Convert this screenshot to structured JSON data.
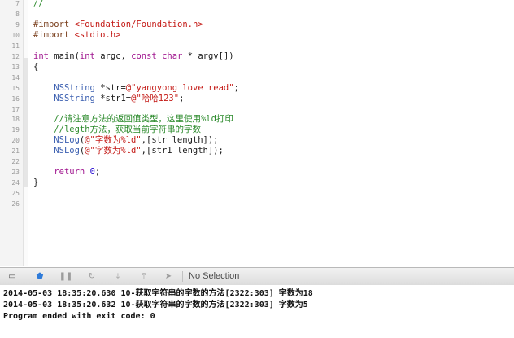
{
  "editor": {
    "line_numbers": [
      "7",
      "8",
      "9",
      "10",
      "11",
      "12",
      "13",
      "14",
      "15",
      "16",
      "17",
      "18",
      "19",
      "20",
      "21",
      "22",
      "23",
      "24",
      "25",
      "26"
    ],
    "lines": [
      {
        "indent": "",
        "tokens": [
          {
            "t": "//",
            "c": "comment"
          }
        ]
      },
      {
        "indent": "",
        "tokens": []
      },
      {
        "indent": "",
        "tokens": [
          {
            "t": "#import ",
            "c": "pre"
          },
          {
            "t": "<Foundation/Foundation.h>",
            "c": "string"
          }
        ]
      },
      {
        "indent": "",
        "tokens": [
          {
            "t": "#import ",
            "c": "pre"
          },
          {
            "t": "<stdio.h>",
            "c": "string"
          }
        ]
      },
      {
        "indent": "",
        "tokens": []
      },
      {
        "indent": "",
        "tokens": [
          {
            "t": "int",
            "c": "keyword"
          },
          {
            "t": " main(",
            "c": "plain"
          },
          {
            "t": "int",
            "c": "keyword"
          },
          {
            "t": " argc, ",
            "c": "plain"
          },
          {
            "t": "const",
            "c": "keyword"
          },
          {
            "t": " ",
            "c": "plain"
          },
          {
            "t": "char",
            "c": "keyword"
          },
          {
            "t": " * argv[])",
            "c": "plain"
          }
        ]
      },
      {
        "indent": "",
        "tokens": [
          {
            "t": "{",
            "c": "plain"
          }
        ]
      },
      {
        "indent": "",
        "tokens": []
      },
      {
        "indent": "    ",
        "tokens": [
          {
            "t": "NSString",
            "c": "type"
          },
          {
            "t": " *str=",
            "c": "plain"
          },
          {
            "t": "@\"yangyong love read\"",
            "c": "string"
          },
          {
            "t": ";",
            "c": "plain"
          }
        ]
      },
      {
        "indent": "    ",
        "tokens": [
          {
            "t": "NSString",
            "c": "type"
          },
          {
            "t": " *str1=",
            "c": "plain"
          },
          {
            "t": "@\"哈哈123\"",
            "c": "string"
          },
          {
            "t": ";",
            "c": "plain"
          }
        ]
      },
      {
        "indent": "",
        "tokens": []
      },
      {
        "indent": "    ",
        "tokens": [
          {
            "t": "//请注意方法的返回值类型，这里使用%ld打印",
            "c": "comment"
          }
        ]
      },
      {
        "indent": "    ",
        "tokens": [
          {
            "t": "//legth方法，获取当前字符串的字数",
            "c": "comment"
          }
        ]
      },
      {
        "indent": "    ",
        "tokens": [
          {
            "t": "NSLog",
            "c": "type"
          },
          {
            "t": "(",
            "c": "plain"
          },
          {
            "t": "@\"字数为%ld\"",
            "c": "string"
          },
          {
            "t": ",[str length]);",
            "c": "plain"
          }
        ]
      },
      {
        "indent": "    ",
        "tokens": [
          {
            "t": "NSLog",
            "c": "type"
          },
          {
            "t": "(",
            "c": "plain"
          },
          {
            "t": "@\"字数为%ld\"",
            "c": "string"
          },
          {
            "t": ",[str1 length]);",
            "c": "plain"
          }
        ]
      },
      {
        "indent": "",
        "tokens": []
      },
      {
        "indent": "    ",
        "tokens": [
          {
            "t": "return",
            "c": "keyword"
          },
          {
            "t": " ",
            "c": "plain"
          },
          {
            "t": "0",
            "c": "number"
          },
          {
            "t": ";",
            "c": "plain"
          }
        ]
      },
      {
        "indent": "",
        "tokens": [
          {
            "t": "}",
            "c": "plain"
          }
        ]
      },
      {
        "indent": "",
        "tokens": []
      },
      {
        "indent": "",
        "tokens": []
      }
    ]
  },
  "debug_bar": {
    "buttons": [
      {
        "name": "hide-debug-area-icon",
        "glyph": "▭"
      },
      {
        "name": "breakpoints-toggle-icon",
        "glyph": "⬟"
      },
      {
        "name": "pause-icon",
        "glyph": "❚❚"
      },
      {
        "name": "continue-icon",
        "glyph": "↻"
      },
      {
        "name": "step-into-icon",
        "glyph": "⤓"
      },
      {
        "name": "step-out-icon",
        "glyph": "⤒"
      },
      {
        "name": "location-icon",
        "glyph": "➤"
      }
    ],
    "selection_label": "No Selection"
  },
  "console": {
    "lines": [
      "2014-05-03 18:35:20.630 10-获取字符串的字数的方法[2322:303] 字数为18",
      "2014-05-03 18:35:20.632 10-获取字符串的字数的方法[2322:303] 字数为5",
      "Program ended with exit code: 0"
    ]
  },
  "colors": {
    "comment": "#2b8a2b",
    "preprocessor": "#7a3f1d",
    "string": "#c41a16",
    "keyword": "#a0168f",
    "type": "#3b5fb0",
    "breakpoint_accent": "#2f7bd9"
  }
}
